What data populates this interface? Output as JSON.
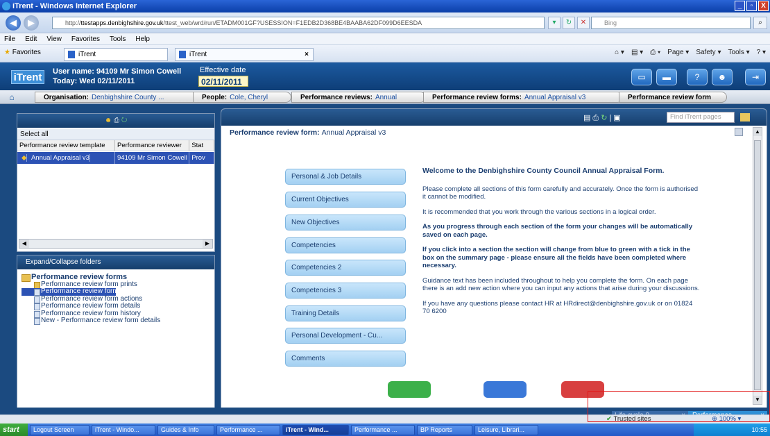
{
  "window": {
    "title": "iTrent - Windows Internet Explorer",
    "controls": [
      "_",
      "▫",
      "X"
    ]
  },
  "address": {
    "url_prefix": "http://",
    "url_host": "ttestapps.denbighshire.gov.uk",
    "url_rest": "/ttest_web/wrd/run/ETADM001GF?USESSION=F1EDB2D368BE4BAABA62DF099D6EESDA",
    "search_placeholder": "Bing"
  },
  "menu": [
    "File",
    "Edit",
    "View",
    "Favorites",
    "Tools",
    "Help"
  ],
  "ie_tabs": {
    "favorites": "Favorites",
    "tab1": "iTrent",
    "tab2": "iTrent",
    "commands": [
      "Page ▾",
      "Safety ▾",
      "Tools ▾"
    ]
  },
  "header": {
    "logo": "iTrent",
    "user_line": "User name: 94109 Mr Simon Cowell",
    "today_line": "Today: Wed 02/11/2011",
    "effective_label": "Effective date",
    "effective_value": "02/11/2011"
  },
  "breadcrumbs": [
    {
      "label": "Organisation:",
      "value": "Denbighshire County ..."
    },
    {
      "label": "People:",
      "value": "Cole, Cheryl"
    },
    {
      "label": "Performance reviews:",
      "value": "Annual"
    },
    {
      "label": "Performance review forms:",
      "value": "Annual Appraisal v3"
    },
    {
      "label": "Performance review form",
      "value": ""
    }
  ],
  "left_top": {
    "select_all": "Select all",
    "columns": [
      "Performance review template",
      "Performance reviewer",
      "Stat"
    ],
    "row": [
      "Annual Appraisal v3",
      "94109 Mr Simon Cowell",
      "Prov"
    ]
  },
  "left_bottom": {
    "header": "Expand/Collapse folders",
    "root": "Performance review forms",
    "items": [
      "Performance review form prints",
      "Performance review form",
      "Performance review form actions",
      "Performance review form details",
      "Performance review form history",
      "New - Performance review form details"
    ]
  },
  "main": {
    "find_placeholder": "Find iTrent pages",
    "form_title_label": "Performance review form:",
    "form_title_value": "Annual Appraisal v3",
    "sections": [
      "Personal & Job Details",
      "Current Objectives",
      "New Objectives",
      "Competencies",
      "Competencies 2",
      "Competencies 3",
      "Training Details",
      "Personal Development - Cu...",
      "Comments"
    ],
    "welcome": "Welcome to the Denbighshire County Council Annual Appraisal Form.",
    "paragraphs": [
      {
        "text": "Please complete all sections of this form carefully and accurately.  Once the form is authorised it cannot be modified.",
        "bold": false
      },
      {
        "text": "It is recommended that you work through the various sections in a logical order.",
        "bold": false
      },
      {
        "text": "As you progress through each section of the form your changes will be automatically saved on each page.",
        "bold": true
      },
      {
        "text": "If you click into a section the section will change from blue to green with a tick in the box on the summary page - please ensure all the fields have been completed where necessary.",
        "bold": true
      },
      {
        "text": "Guidance text has been included throughout to help you complete the form. On each page there is an add new action where you can input any actions that arise during your discussions.",
        "bold": false
      },
      {
        "text": "If you have any questions please contact HR at HRdirect@denbighshire.gov.uk or on 01824 70 6200",
        "bold": false
      }
    ],
    "bottom_button_colors": [
      "#3cb04a",
      "#3a78d8",
      "#d84040"
    ]
  },
  "status": {
    "lifecycle": "Life cycle,0...",
    "performance": "Performance ...",
    "trusted": "Trusted sites",
    "zoom": "100%"
  },
  "taskbar": {
    "start": "start",
    "items": [
      "Logout Screen",
      "iTrent - Windo...",
      "Guides & Info",
      "Performance ...",
      "iTrent - Wind...",
      "Performance ...",
      "BP Reports",
      "Leisure, Librari..."
    ],
    "clock": "10:55"
  }
}
